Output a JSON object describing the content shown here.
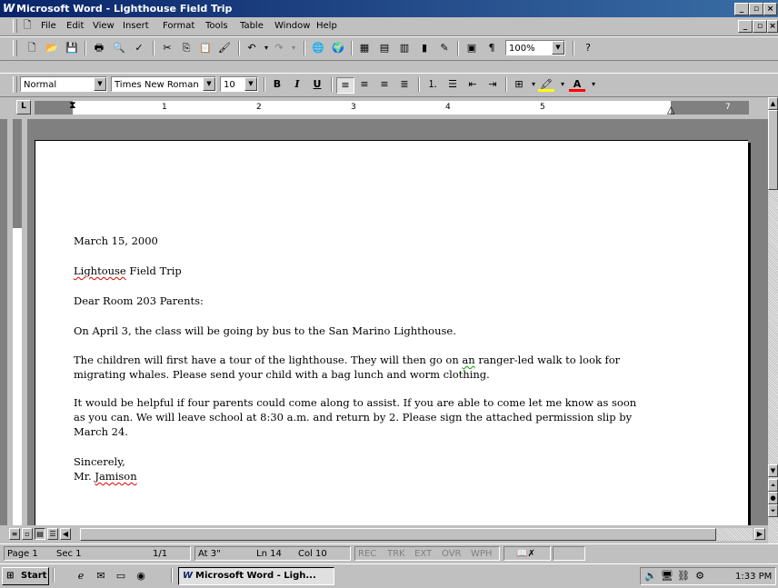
{
  "window": {
    "title": "Microsoft Word - Lighthouse Field Trip"
  },
  "menu": [
    "File",
    "Edit",
    "View",
    "Insert",
    "Format",
    "Tools",
    "Table",
    "Window",
    "Help"
  ],
  "formatting": {
    "style": "Normal",
    "font": "Times New Roman",
    "size": "10",
    "zoom": "100%"
  },
  "ruler": {
    "numbers": [
      "1",
      "2",
      "3",
      "4",
      "5",
      "7"
    ]
  },
  "document": {
    "date": "March 15, 2000",
    "subject_misspelled": "Lightouse",
    "subject_rest": " Field Trip",
    "greeting": "Dear Room 203 Parents:",
    "p1": "On April 3, the class will be going by bus to the San Marino Lighthouse.",
    "p2_line1_a": "The children will first have a tour of the lighthouse. They will then go on ",
    "p2_line1_err": "an",
    "p2_line1_b": " ranger-led walk to look for",
    "p2_line2": "migrating whales. Please send your child with a bag lunch and worm clothing.",
    "p3_line1": "It would be helpful if four parents could come along to assist. If you are able to come let me know as soon",
    "p3_line2": "as you can. We will leave school at 8:30 a.m. and return by 2. Please sign the attached permission slip by",
    "p3_line3": "March 24.",
    "closing": "Sincerely,",
    "signer_prefix": "Mr. ",
    "signer_name": "Jamison"
  },
  "status": {
    "page": "Page 1",
    "sec": "Sec 1",
    "pages": "1/1",
    "at": "At 3\"",
    "ln": "Ln 14",
    "col": "Col 10",
    "rec": "REC",
    "trk": "TRK",
    "ext": "EXT",
    "ovr": "OVR",
    "wph": "WPH"
  },
  "taskbar": {
    "start": "Start",
    "task": "Microsoft Word - Ligh...",
    "clock": "1:33 PM"
  }
}
